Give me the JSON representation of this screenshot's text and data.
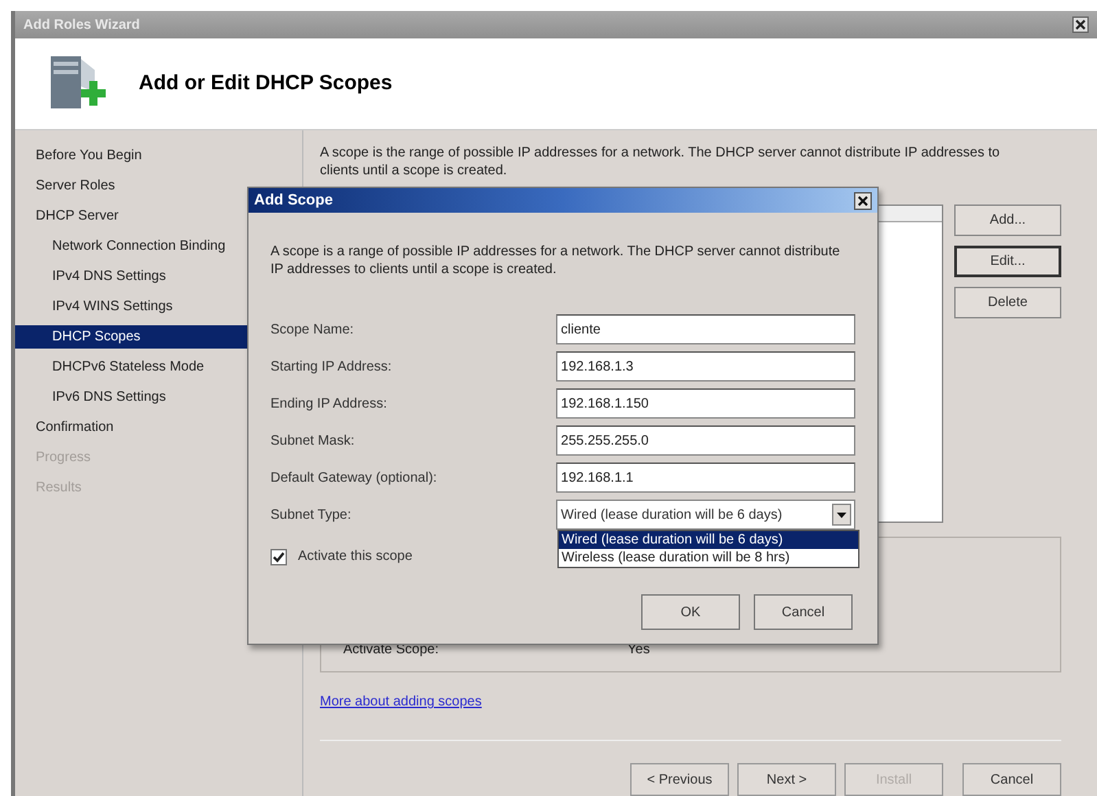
{
  "window": {
    "title": "Add Roles Wizard"
  },
  "header": {
    "title": "Add or Edit DHCP Scopes"
  },
  "nav": [
    {
      "label": "Before You Begin",
      "selected": false,
      "disabled": false
    },
    {
      "label": "Server Roles",
      "selected": false,
      "disabled": false
    },
    {
      "label": "DHCP Server",
      "selected": false,
      "disabled": false,
      "children": [
        {
          "label": "Network Connection Binding",
          "selected": false,
          "disabled": false
        },
        {
          "label": "IPv4 DNS Settings",
          "selected": false,
          "disabled": false
        },
        {
          "label": "IPv4 WINS Settings",
          "selected": false,
          "disabled": false
        },
        {
          "label": "DHCP Scopes",
          "selected": true,
          "disabled": false
        },
        {
          "label": "DHCPv6 Stateless Mode",
          "selected": false,
          "disabled": false
        },
        {
          "label": "IPv6 DNS Settings",
          "selected": false,
          "disabled": false
        }
      ]
    },
    {
      "label": "Confirmation",
      "selected": false,
      "disabled": false
    },
    {
      "label": "Progress",
      "selected": false,
      "disabled": true
    },
    {
      "label": "Results",
      "selected": false,
      "disabled": true
    }
  ],
  "content": {
    "description": "A scope is the range of possible IP addresses for a network. The DHCP server cannot distribute IP addresses to clients until a scope is created.",
    "scope_buttons": [
      {
        "label": "Add...",
        "focused": false
      },
      {
        "label": "Edit...",
        "focused": true
      },
      {
        "label": "Delete",
        "focused": false
      }
    ],
    "properties": [
      {
        "label": "Activate Scope:",
        "value": "Yes"
      }
    ],
    "link": "More about adding scopes"
  },
  "footer_buttons": [
    {
      "label": "< Previous",
      "disabled": false
    },
    {
      "label": "Next >",
      "disabled": false
    },
    {
      "label": "Install",
      "disabled": true
    },
    {
      "label": "Cancel",
      "disabled": false
    }
  ],
  "dialog": {
    "title": "Add Scope",
    "description": "A scope is a range of possible IP addresses for a network. The DHCP server cannot distribute IP addresses to clients until a scope is created.",
    "fields": [
      {
        "label": "Scope Name:",
        "value": "cliente"
      },
      {
        "label": "Starting IP Address:",
        "value": "192.168.1.3"
      },
      {
        "label": "Ending IP Address:",
        "value": "192.168.1.150"
      },
      {
        "label": "Subnet Mask:",
        "value": "255.255.255.0"
      },
      {
        "label": "Default Gateway (optional):",
        "value": "192.168.1.1"
      }
    ],
    "subnet_type": {
      "label": "Subnet Type:",
      "value": "Wired (lease duration will be 6 days)",
      "expanded": true,
      "options": [
        {
          "label": "Wired (lease duration will be 6 days)",
          "selected": true
        },
        {
          "label": "Wireless (lease duration will be 8 hrs)",
          "selected": false
        }
      ]
    },
    "activate": {
      "label": "Activate this scope",
      "checked": true
    },
    "buttons": [
      "OK",
      "Cancel"
    ]
  }
}
